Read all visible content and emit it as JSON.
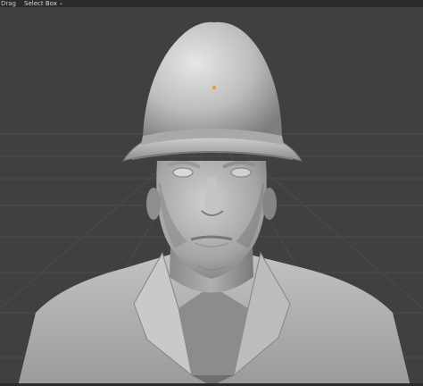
{
  "header": {
    "tool_label": "Drag",
    "select_mode": "Select Box",
    "dropdown_icon": "chevron-down-icon"
  },
  "viewport": {
    "background": "#404040",
    "grid_color": "#4c4c4c",
    "model_color": "#b8b8b8",
    "origin_color": "#e0a030",
    "model_name": "sculpted-bust-with-helmet"
  }
}
